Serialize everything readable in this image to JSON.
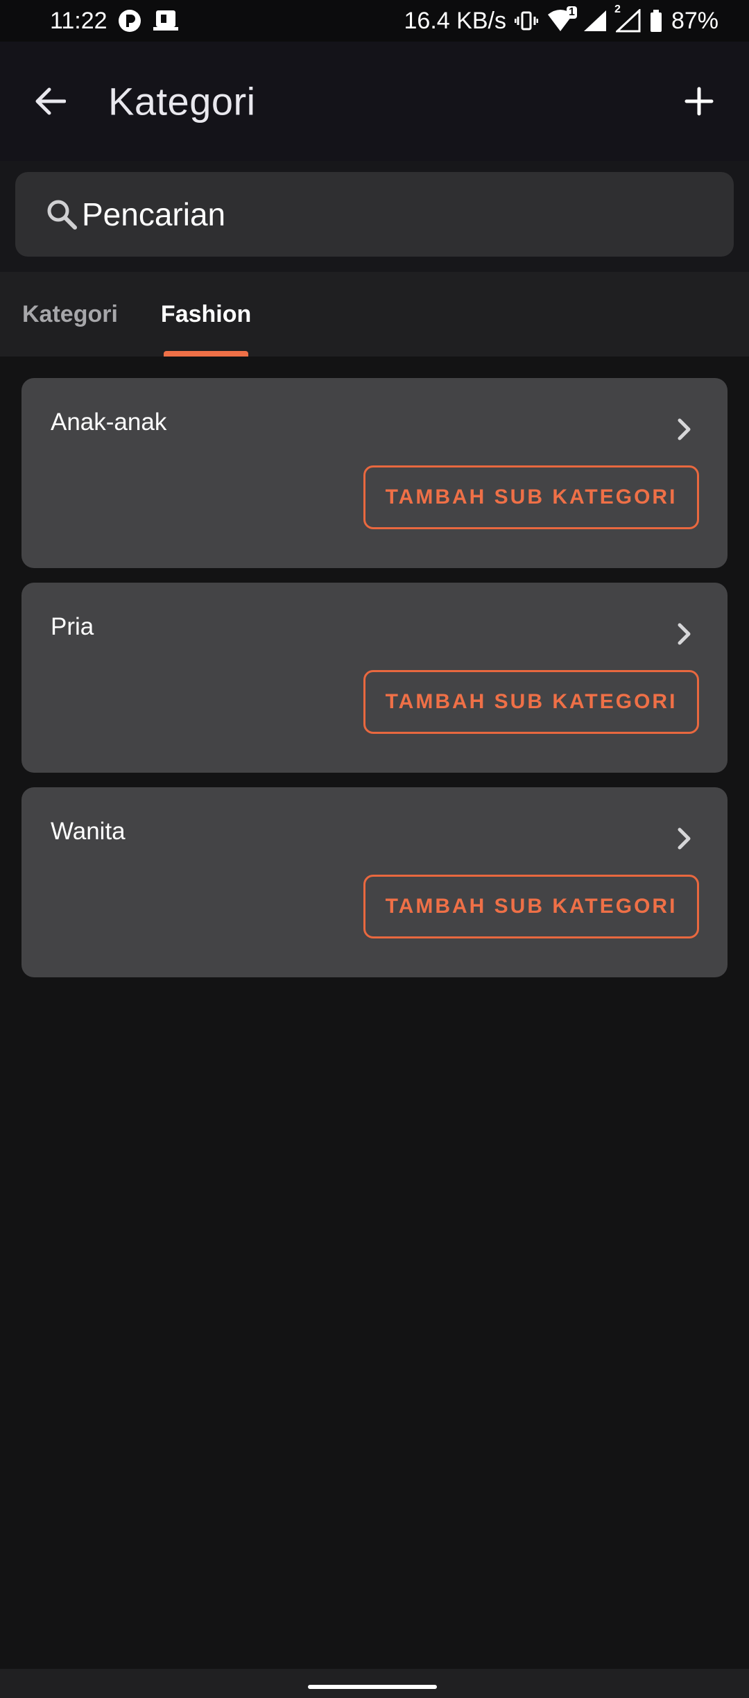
{
  "status_bar": {
    "time": "11:22",
    "net_speed": "16.4 KB/s",
    "battery": "87%",
    "sim1": "1",
    "sim2": "2",
    "icons": [
      "notification-app-icon",
      "notification-app2-icon",
      "vibrate-icon",
      "wifi-icon",
      "signal-sim1-icon",
      "signal-sim2-icon",
      "battery-icon"
    ]
  },
  "app_bar": {
    "title": "Kategori",
    "back_icon": "arrow-left-icon",
    "add_icon": "plus-icon"
  },
  "search": {
    "placeholder": "Pencarian",
    "icon": "search-icon"
  },
  "tabs": [
    {
      "label": "Kategori",
      "active": false
    },
    {
      "label": "Fashion",
      "active": true
    }
  ],
  "categories": [
    {
      "name": "Anak-anak",
      "button_label": "TAMBAH SUB KATEGORI"
    },
    {
      "name": "Pria",
      "button_label": "TAMBAH SUB KATEGORI"
    },
    {
      "name": "Wanita",
      "button_label": "TAMBAH SUB KATEGORI"
    }
  ],
  "colors": {
    "accent": "#ef7047",
    "card": "#444446",
    "background": "#131314"
  }
}
